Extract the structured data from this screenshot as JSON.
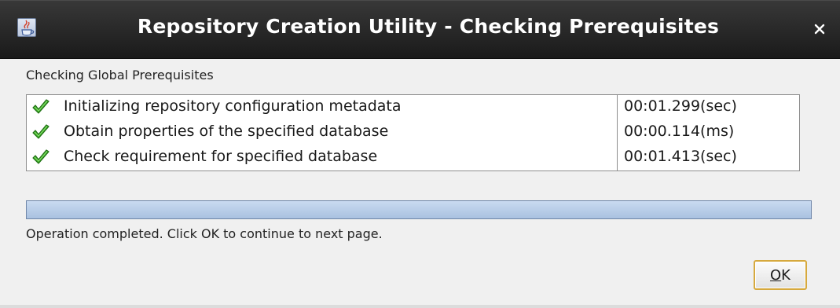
{
  "window": {
    "title": "Repository Creation Utility - Checking Prerequisites",
    "app_icon": "java-coffee-cup-icon",
    "close_icon": "close-icon",
    "titlebar_color": "#2a2a2a"
  },
  "section": {
    "heading": "Checking Global Prerequisites"
  },
  "prerequisites": [
    {
      "status_icon": "green-check-icon",
      "name": "Initializing repository configuration metadata",
      "time": "00:01.299(sec)"
    },
    {
      "status_icon": "green-check-icon",
      "name": "Obtain properties of the specified database",
      "time": "00:00.114(ms)"
    },
    {
      "status_icon": "green-check-icon",
      "name": "Check requirement for specified database",
      "time": "00:01.413(sec)"
    }
  ],
  "progress": {
    "fraction": 1.0,
    "fill_color": "#b7cbe6"
  },
  "status": {
    "message": "Operation completed. Click OK to continue to next page."
  },
  "buttons": {
    "ok_mnemonic": "O",
    "ok_rest": "K",
    "ok_border_color": "#d6a93e"
  }
}
